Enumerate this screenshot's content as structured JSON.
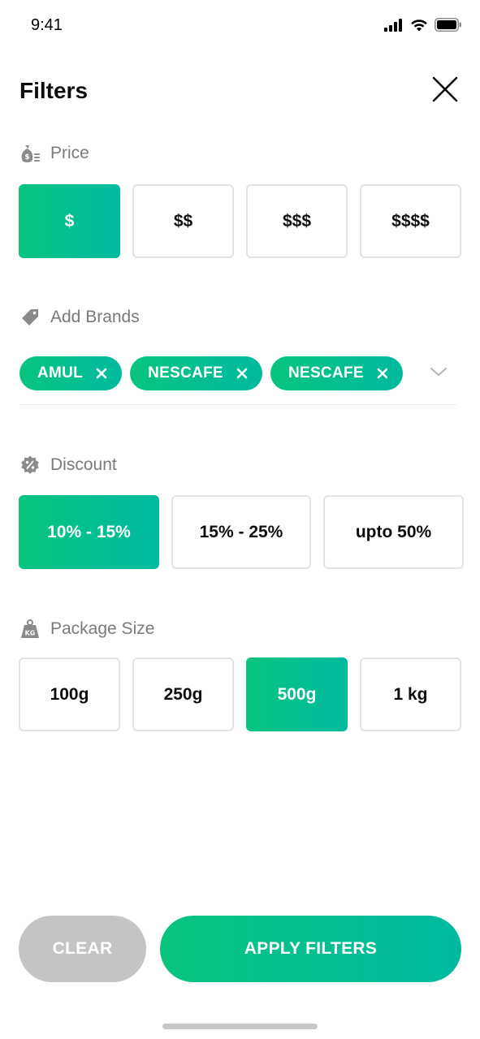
{
  "status_bar": {
    "time": "9:41"
  },
  "header": {
    "title": "Filters"
  },
  "price": {
    "label": "Price",
    "options": [
      {
        "label": "$",
        "selected": true
      },
      {
        "label": "$$",
        "selected": false
      },
      {
        "label": "$$$",
        "selected": false
      },
      {
        "label": "$$$$",
        "selected": false
      }
    ]
  },
  "brands": {
    "label": "Add Brands",
    "chips": [
      "AMUL",
      "NESCAFE",
      "NESCAFE"
    ]
  },
  "discount": {
    "label": "Discount",
    "options": [
      {
        "label": "10% - 15%",
        "selected": true
      },
      {
        "label": "15% - 25%",
        "selected": false
      },
      {
        "label": "upto 50%",
        "selected": false
      }
    ]
  },
  "package_size": {
    "label": "Package Size",
    "options": [
      {
        "label": "100g",
        "selected": false
      },
      {
        "label": "250g",
        "selected": false
      },
      {
        "label": "500g",
        "selected": true
      },
      {
        "label": "1 kg",
        "selected": false
      }
    ]
  },
  "actions": {
    "clear_label": "CLEAR",
    "apply_label": "APPLY FILTERS"
  },
  "colors": {
    "accent_start": "#08c47e",
    "accent_end": "#00baa0",
    "muted": "#c4c4c4",
    "label_gray": "#7a7a7a"
  },
  "icons": {
    "price": "money-bag-icon",
    "brands": "tag-icon",
    "discount": "discount-badge-icon",
    "package": "weight-kg-icon",
    "close": "close-icon",
    "chip_remove": "remove-x-icon",
    "expand": "chevron-down-icon"
  }
}
